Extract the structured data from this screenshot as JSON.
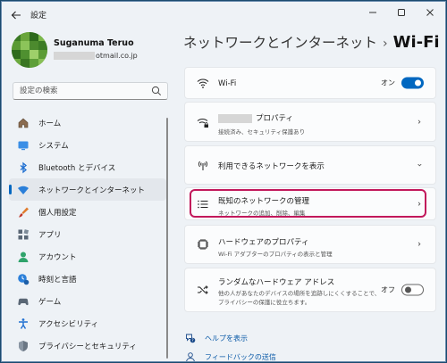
{
  "window": {
    "title": "設定"
  },
  "profile": {
    "name": "Suganuma Teruo",
    "email_suffix": "otmail.co.jp"
  },
  "search": {
    "placeholder": "設定の検索"
  },
  "nav": {
    "items": [
      {
        "label": "ホーム",
        "icon": "home-icon"
      },
      {
        "label": "システム",
        "icon": "system-icon"
      },
      {
        "label": "Bluetooth とデバイス",
        "icon": "bluetooth-icon"
      },
      {
        "label": "ネットワークとインターネット",
        "icon": "network-icon",
        "active": true
      },
      {
        "label": "個人用設定",
        "icon": "brush-icon"
      },
      {
        "label": "アプリ",
        "icon": "apps-icon"
      },
      {
        "label": "アカウント",
        "icon": "account-icon"
      },
      {
        "label": "時刻と言語",
        "icon": "time-language-icon"
      },
      {
        "label": "ゲーム",
        "icon": "game-icon"
      },
      {
        "label": "アクセシビリティ",
        "icon": "accessibility-icon"
      },
      {
        "label": "プライバシーとセキュリティ",
        "icon": "shield-icon"
      }
    ]
  },
  "breadcrumb": {
    "parent": "ネットワークとインターネット",
    "separator": "›",
    "current": "Wi-Fi"
  },
  "cards": {
    "wifi": {
      "title": "Wi-Fi",
      "toggle_label": "オン",
      "toggle_on": true
    },
    "properties": {
      "title_suffix": "プロパティ",
      "subtitle": "接続済み、セキュリティ保護あり"
    },
    "available": {
      "title": "利用できるネットワークを表示"
    },
    "known": {
      "title": "既知のネットワークの管理",
      "subtitle": "ネットワークの追加、削除、編集"
    },
    "hardware": {
      "title": "ハードウェアのプロパティ",
      "subtitle": "Wi-Fi アダプターのプロパティの表示と管理"
    },
    "random": {
      "title": "ランダムなハードウェア アドレス",
      "subtitle_line1": "他の人があなたのデバイスの場所を追跡しにくくすることで、",
      "subtitle_line2": "プライバシーの保護に役立ちます。",
      "toggle_label": "オフ",
      "toggle_on": false
    }
  },
  "links": {
    "help": "ヘルプを表示",
    "feedback": "フィードバックの送信"
  },
  "colors": {
    "accent": "#0067c0",
    "highlight": "#c2185b",
    "background": "#eef2f6"
  }
}
